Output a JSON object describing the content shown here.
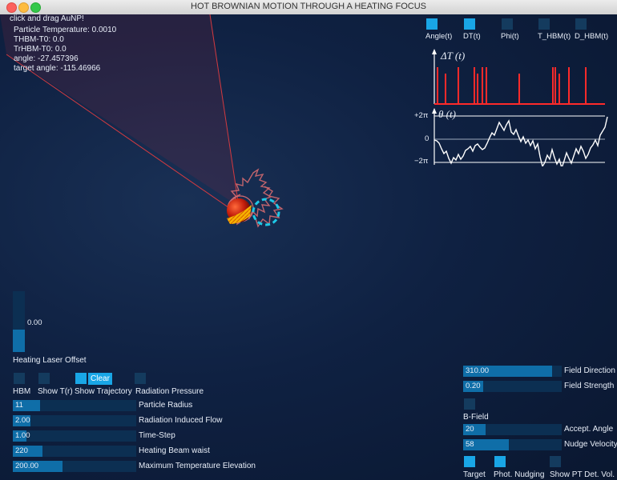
{
  "window": {
    "title": "HOT BROWNIAN MOTION THROUGH A HEATING FOCUS"
  },
  "info": {
    "hint": "click and drag AuNP!",
    "particle_temperature": "Particle Temperature: 0.0010",
    "thbm": "THBM-T0: 0.0",
    "trhbm": "TrHBM-T0: 0.0",
    "angle": "angle: -27.457396",
    "target_angle": "target angle: -115.46966"
  },
  "plot_toggles": [
    {
      "label": "Angle(t)",
      "on": true
    },
    {
      "label": "DT(t)",
      "on": true
    },
    {
      "label": "Phi(t)",
      "on": false
    },
    {
      "label": "T_HBM(t)",
      "on": false
    },
    {
      "label": "D_HBM(t)",
      "on": false
    }
  ],
  "plots": {
    "dt_label": "ΔT (t)",
    "theta_label": "θ (t)",
    "theta_top": "+2π",
    "theta_zero": "0",
    "theta_bottom": "−2π"
  },
  "laser_offset": {
    "value": "0.00",
    "label": "Heating Laser Offset",
    "level": 0.37
  },
  "checkboxes": [
    {
      "label": "HBM",
      "on": false
    },
    {
      "label": "Show T(r)",
      "on": false
    },
    {
      "label": "Show Trajectory",
      "on": true
    },
    {
      "label": "Radiation Pressure",
      "on": false
    }
  ],
  "clear_label": "Clear",
  "left_sliders": [
    {
      "value": "11",
      "label": "Particle Radius",
      "fraction": 0.22
    },
    {
      "value": "2.00",
      "label": "Radiation Induced Flow",
      "fraction": 0.14
    },
    {
      "value": "1.00",
      "label": "Time-Step",
      "fraction": 0.11
    },
    {
      "value": "220",
      "label": "Heating Beam waist",
      "fraction": 0.24
    },
    {
      "value": "200.00",
      "label": "Maximum Temperature Elevation",
      "fraction": 0.4
    }
  ],
  "right_sliders": [
    {
      "value": "310.00",
      "label": "Field Direction",
      "fraction": 0.9
    },
    {
      "value": "0.20",
      "label": "Field Strength",
      "fraction": 0.2
    },
    {
      "value": "20",
      "label": "Accept. Angle",
      "fraction": 0.23
    },
    {
      "value": "58",
      "label": "Nudge Velocity",
      "fraction": 0.46
    }
  ],
  "bfield": {
    "label": "B-Field",
    "on": false
  },
  "bottom_toggles": [
    {
      "label": "Target",
      "on": true
    },
    {
      "label": "Phot. Nudging",
      "on": true
    },
    {
      "label": "Show PT Det. Vol.",
      "on": false
    }
  ],
  "colors": {
    "accent": "#19a6e6",
    "slider_bg": "#0c2f52",
    "slider_fill": "#0f6ea8",
    "dt_spike": "#ff2a2a"
  }
}
